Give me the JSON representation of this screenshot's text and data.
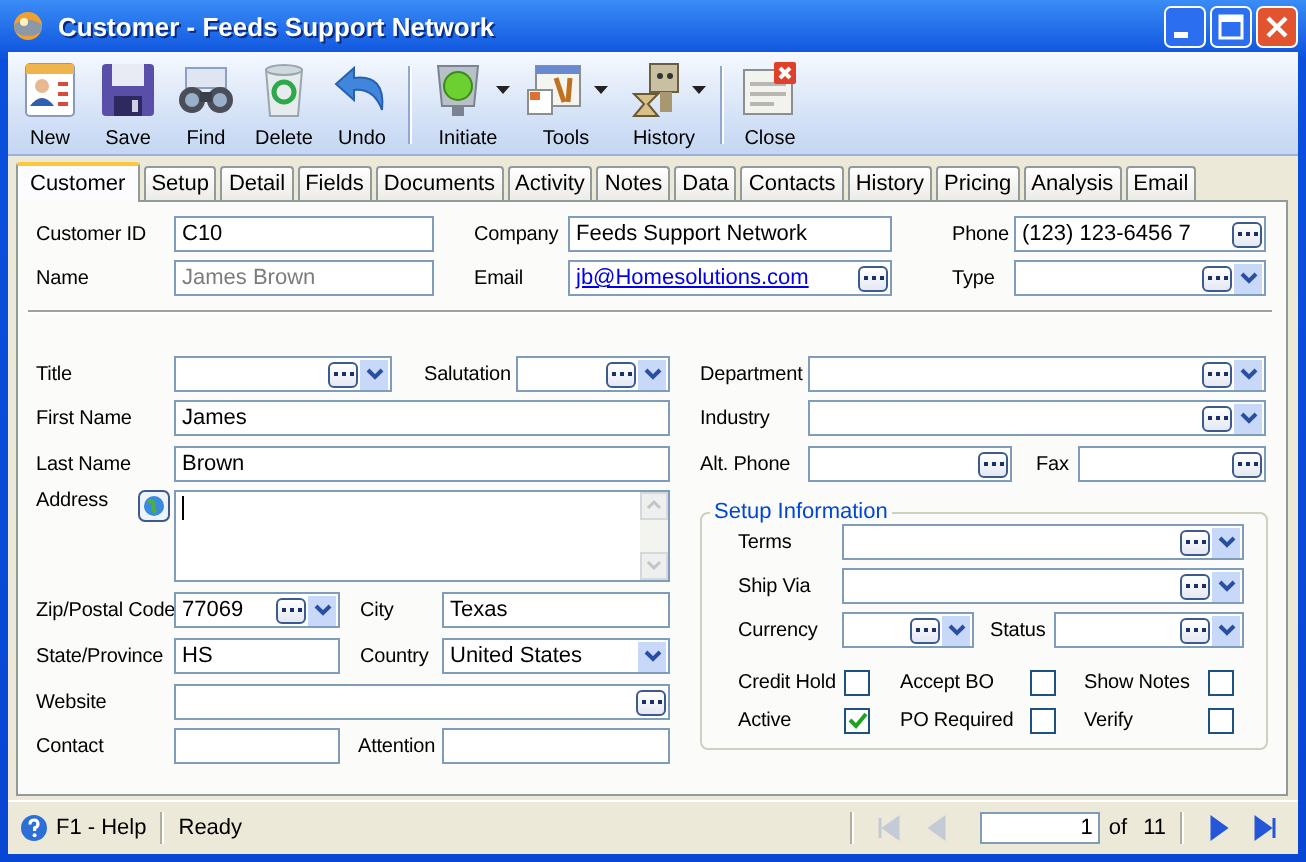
{
  "window": {
    "title": "Customer - Feeds Support Network"
  },
  "toolbar": [
    [
      {
        "label": "New",
        "has_menu": false
      },
      {
        "label": "Save",
        "has_menu": false
      },
      {
        "label": "Find",
        "has_menu": false
      },
      {
        "label": "Delete",
        "has_menu": false
      },
      {
        "label": "Undo",
        "has_menu": false
      }
    ],
    [
      {
        "label": "Initiate",
        "has_menu": true
      },
      {
        "label": "Tools",
        "has_menu": true
      },
      {
        "label": "History",
        "has_menu": true
      }
    ],
    [
      {
        "label": "Close",
        "has_menu": false
      }
    ]
  ],
  "tabs": [
    {
      "label": "Customer",
      "selected": true
    },
    {
      "label": "Setup",
      "selected": false
    },
    {
      "label": "Detail",
      "selected": false
    },
    {
      "label": "Fields",
      "selected": false
    },
    {
      "label": "Documents",
      "selected": false
    },
    {
      "label": "Activity",
      "selected": false
    },
    {
      "label": "Notes",
      "selected": false
    },
    {
      "label": "Data",
      "selected": false
    },
    {
      "label": "Contacts",
      "selected": false
    },
    {
      "label": "History",
      "selected": false
    },
    {
      "label": "Pricing",
      "selected": false
    },
    {
      "label": "Analysis",
      "selected": false
    },
    {
      "label": "Email",
      "selected": false
    }
  ],
  "header": {
    "customer_id": {
      "label": "Customer ID",
      "kind": "text",
      "value": "C10"
    },
    "company": {
      "label": "Company",
      "kind": "text",
      "value": "Feeds Support Network"
    },
    "phone": {
      "label": "Phone",
      "kind": "lookup",
      "value": "(123) 123-6456 7"
    },
    "name": {
      "label": "Name",
      "kind": "text",
      "value": "James Brown",
      "disabled": true
    },
    "email": {
      "label": "Email",
      "kind": "link",
      "value": "jb@Homesolutions.com"
    },
    "type": {
      "label": "Type",
      "kind": "combo"
    }
  },
  "contact": {
    "title": {
      "label": "Title",
      "kind": "combo"
    },
    "salutation": {
      "label": "Salutation",
      "kind": "combo"
    },
    "first_name": {
      "label": "First Name",
      "kind": "text",
      "value": "James"
    },
    "last_name": {
      "label": "Last Name",
      "kind": "text",
      "value": "Brown"
    },
    "address": {
      "label": "Address",
      "kind": "memo"
    },
    "zip": {
      "label": "Zip/Postal Code",
      "kind": "combo",
      "value": "77069"
    },
    "city": {
      "label": "City",
      "kind": "text",
      "value": "Texas"
    },
    "state": {
      "label": "State/Province",
      "kind": "text",
      "value": "HS"
    },
    "country": {
      "label": "Country",
      "kind": "dropdown",
      "value": "United States"
    },
    "website": {
      "label": "Website",
      "kind": "lookup"
    },
    "contact": {
      "label": "Contact",
      "kind": "text"
    },
    "attention": {
      "label": "Attention",
      "kind": "text"
    },
    "department": {
      "label": "Department",
      "kind": "combo"
    },
    "industry": {
      "label": "Industry",
      "kind": "combo"
    },
    "alt_phone": {
      "label": "Alt. Phone",
      "kind": "lookup"
    },
    "fax": {
      "label": "Fax",
      "kind": "lookup"
    }
  },
  "setup": {
    "title": "Setup Information",
    "terms": {
      "label": "Terms",
      "kind": "combo"
    },
    "ship_via": {
      "label": "Ship Via",
      "kind": "combo"
    },
    "currency": {
      "label": "Currency",
      "kind": "combo"
    },
    "status": {
      "label": "Status",
      "kind": "combo"
    },
    "options": [
      {
        "label": "Credit Hold",
        "checked": false
      },
      {
        "label": "Accept BO",
        "checked": false
      },
      {
        "label": "Show Notes",
        "checked": false
      },
      {
        "label": "Active",
        "checked": true
      },
      {
        "label": "PO Required",
        "checked": false
      },
      {
        "label": "Verify",
        "checked": false
      }
    ]
  },
  "status_bar": {
    "help": "F1 - Help",
    "message": "Ready",
    "page": "1",
    "of_label": "of",
    "total": "11",
    "nav": [
      {
        "kind": "first",
        "disabled": true
      },
      {
        "kind": "prev",
        "disabled": true
      },
      {
        "kind": "next",
        "disabled": false
      },
      {
        "kind": "last",
        "disabled": false
      }
    ]
  }
}
